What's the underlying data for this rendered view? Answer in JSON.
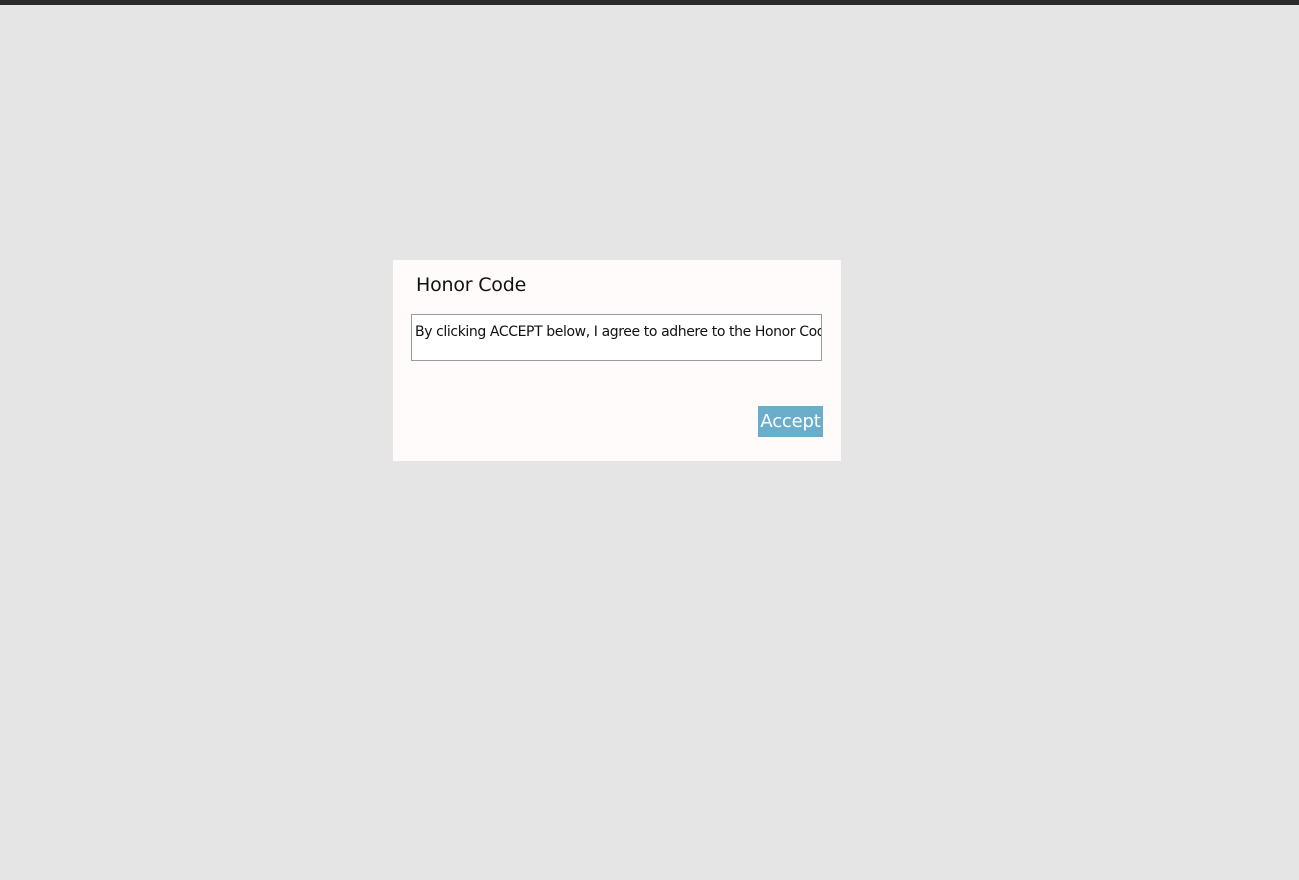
{
  "dialog": {
    "title": "Honor Code",
    "agreement_text": "By clicking ACCEPT below, I agree to adhere to the Honor Code.",
    "accept_label": "Accept"
  },
  "colors": {
    "background": "#e5e5e5",
    "top_bar": "#2b2b2b",
    "dialog_background": "#fefbfa",
    "accent": "#6aaecb"
  }
}
